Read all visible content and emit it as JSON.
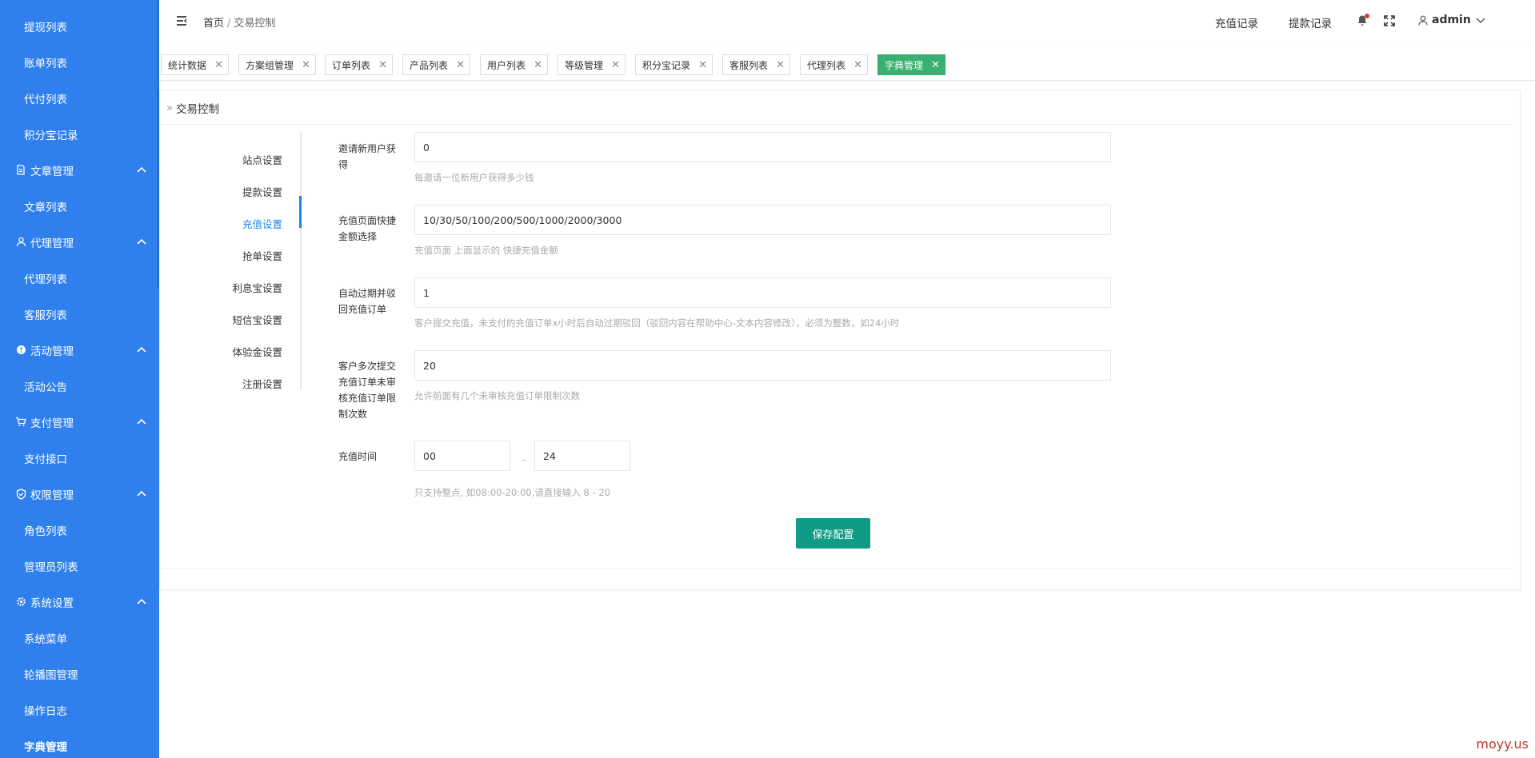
{
  "sidebar": {
    "items": [
      {
        "type": "sub",
        "label": "提现列表"
      },
      {
        "type": "sub",
        "label": "账单列表"
      },
      {
        "type": "sub",
        "label": "代付列表"
      },
      {
        "type": "sub",
        "label": "积分宝记录"
      },
      {
        "type": "group",
        "label": "文章管理",
        "icon": "document-icon"
      },
      {
        "type": "sub",
        "label": "文章列表"
      },
      {
        "type": "group",
        "label": "代理管理",
        "icon": "user-icon"
      },
      {
        "type": "sub",
        "label": "代理列表"
      },
      {
        "type": "sub",
        "label": "客服列表"
      },
      {
        "type": "group",
        "label": "活动管理",
        "icon": "activity-icon"
      },
      {
        "type": "sub",
        "label": "活动公告"
      },
      {
        "type": "group",
        "label": "支付管理",
        "icon": "cart-icon"
      },
      {
        "type": "sub",
        "label": "支付接口"
      },
      {
        "type": "group",
        "label": "权限管理",
        "icon": "shield-icon"
      },
      {
        "type": "sub",
        "label": "角色列表"
      },
      {
        "type": "sub",
        "label": "管理员列表"
      },
      {
        "type": "group",
        "label": "系统设置",
        "icon": "gear-icon"
      },
      {
        "type": "sub",
        "label": "系统菜单"
      },
      {
        "type": "sub",
        "label": "轮播图管理"
      },
      {
        "type": "sub",
        "label": "操作日志"
      },
      {
        "type": "sub",
        "label": "字典管理",
        "active": true
      }
    ]
  },
  "header": {
    "breadcrumb": {
      "home": "首页",
      "separator": "/",
      "current": "交易控制"
    },
    "links": {
      "recharge": "充值记录",
      "withdraw": "提款记录"
    },
    "user": "admin"
  },
  "tabs": [
    {
      "label": "统计数据"
    },
    {
      "label": "方案组管理"
    },
    {
      "label": "订单列表"
    },
    {
      "label": "产品列表"
    },
    {
      "label": "用户列表"
    },
    {
      "label": "等级管理"
    },
    {
      "label": "积分宝记录"
    },
    {
      "label": "客服列表"
    },
    {
      "label": "代理列表"
    },
    {
      "label": "字典管理",
      "active": true
    }
  ],
  "page": {
    "title": "交易控制",
    "nav": [
      {
        "label": "站点设置"
      },
      {
        "label": "提款设置"
      },
      {
        "label": "充值设置",
        "active": true
      },
      {
        "label": "抢单设置"
      },
      {
        "label": "利息宝设置"
      },
      {
        "label": "短信宝设置"
      },
      {
        "label": "体验金设置"
      },
      {
        "label": "注册设置"
      }
    ],
    "form": {
      "invite": {
        "label": "邀请新用户获得",
        "value": "0",
        "help": "每邀请一位新用户获得多少钱"
      },
      "amounts": {
        "label": "充值页面快捷金额选择",
        "value": "10/30/50/100/200/500/1000/2000/3000",
        "help": "充值页面 上面显示的 快捷充值金额"
      },
      "expire": {
        "label": "自动过期并驳回充值订单",
        "value": "1",
        "help": "客户提交充值，未支付的充值订单x小时后自动过期驳回（驳回内容在帮助中心-文本内容修改），必须为整数，如24小时"
      },
      "limit": {
        "label": "客户多次提交充值订单未审核充值订单限制次数",
        "value": "20",
        "help": "允许前面有几个未审核充值订单限制次数"
      },
      "time": {
        "label": "充值时间",
        "start": "00",
        "dash": "-",
        "end": "24",
        "help": "只支持整点, 如08:00-20:00,请直接输入 8 - 20"
      }
    },
    "save_label": "保存配置"
  },
  "watermark": "moyy.us",
  "colors": {
    "sidebar": "#2f80ed",
    "accent": "#1e88e5",
    "tab_active": "#38b06f",
    "button": "#0f9b86"
  }
}
